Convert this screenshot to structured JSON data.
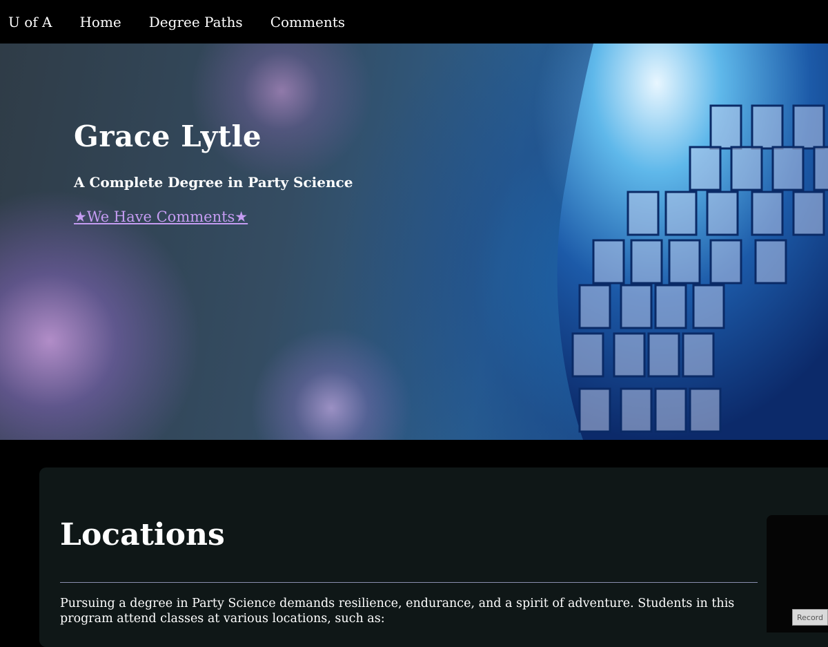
{
  "nav": {
    "brand": "U of A",
    "items": [
      "Home",
      "Degree Paths",
      "Comments"
    ]
  },
  "hero": {
    "title": "Grace Lytle",
    "subtitle": "A Complete Degree in Party Science",
    "link": "★We Have Comments★"
  },
  "section": {
    "title": "Locations",
    "body": "Pursuing a degree in Party Science demands resilience, endurance, and a spirit of adventure. Students in this program attend classes at various locations, such as:"
  },
  "widget": {
    "record_label": "Record"
  },
  "colors": {
    "link": "#c59cf2",
    "card_bg": "#0f1717",
    "nav_bg": "#000000"
  }
}
